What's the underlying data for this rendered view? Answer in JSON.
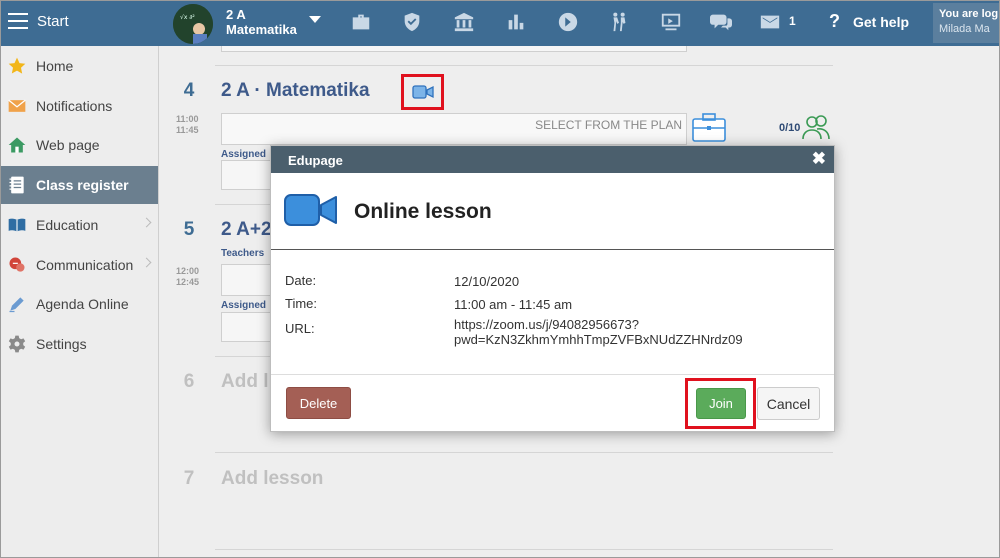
{
  "topbar": {
    "start_label": "Start",
    "class_line1": "2 A",
    "class_line2": "Matematika",
    "icons": [
      "briefcase-icon",
      "shield-icon",
      "bank-icon",
      "bar-chart-icon",
      "plan-icon",
      "students-icon",
      "board-icon",
      "chat-icon",
      "mail-icon"
    ],
    "mail_count": "1",
    "help_symbol": "?",
    "help_label": "Get help",
    "user_line1": "You are log",
    "user_line2": "Milada Ma"
  },
  "sidebar": {
    "items": [
      {
        "label": "Home",
        "icon": "star-icon"
      },
      {
        "label": "Notifications",
        "icon": "envelope-icon"
      },
      {
        "label": "Web page",
        "icon": "house-icon"
      },
      {
        "label": "Class register",
        "icon": "notebook-icon",
        "active": true
      },
      {
        "label": "Education",
        "icon": "book-icon",
        "submenu": true
      },
      {
        "label": "Communication",
        "icon": "chat-bubbles-icon",
        "submenu": true
      },
      {
        "label": "Agenda Online",
        "icon": "pen-icon"
      },
      {
        "label": "Settings",
        "icon": "gear-icon"
      }
    ]
  },
  "lessons": {
    "l4": {
      "num": "4",
      "title": "2 A · Matematika",
      "time_start": "11:00",
      "time_end": "11:45",
      "plan_label": "SELECT FROM THE PLAN",
      "assigned_label": "Assigned",
      "count": "0/10"
    },
    "l5": {
      "num": "5",
      "title": "2 A+2",
      "teachers_label": "Teachers",
      "time_start": "12:00",
      "time_end": "12:45",
      "assigned_label": "Assigned"
    },
    "l6": {
      "num": "6",
      "title": "Add l"
    },
    "l7": {
      "num": "7",
      "title": "Add lesson"
    }
  },
  "modal": {
    "header": "Edupage",
    "close_symbol": "✖",
    "title": "Online lesson",
    "date_label": "Date:",
    "date_value": "12/10/2020",
    "time_label": "Time:",
    "time_value": "11:00 am - 11:45 am",
    "url_label": "URL:",
    "url_line1": "https://zoom.us/j/94082956673?",
    "url_line2": "pwd=KzN3ZkhmYmhhTmpZVFBxNUdZZHNrdz09",
    "delete_label": "Delete",
    "join_label": "Join",
    "cancel_label": "Cancel"
  },
  "colors": {
    "topbar": "#3e6c93",
    "sidebar_active": "#6b7f8f",
    "modal_header": "#4b5f6d",
    "join": "#5bab5b",
    "delete": "#a45f55",
    "highlight": "#e0111e",
    "video_icon": "#3c8fdc"
  }
}
